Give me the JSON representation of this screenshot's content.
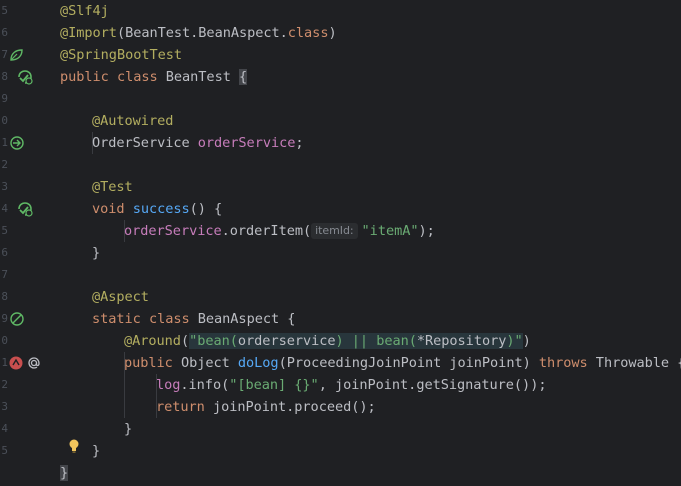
{
  "editor": {
    "line_numbers": [
      "5",
      "6",
      "7",
      "8",
      "9",
      "0",
      "1",
      "2",
      "3",
      "4",
      "5",
      "6",
      "7",
      "8",
      "9",
      "0",
      "1",
      "2",
      "3",
      "4",
      "5"
    ],
    "lines": {
      "l1": {
        "anno": "@Slf4j"
      },
      "l2": {
        "anno": "@Import",
        "p1": "(BeanTest.BeanAspect.",
        "kw": "class",
        "p2": ")"
      },
      "l3": {
        "anno": "@SpringBootTest"
      },
      "l4": {
        "kw1": "public",
        "kw2": "class",
        "p1": " BeanTest ",
        "brace": "{"
      },
      "l6": {
        "anno": "@Autowired"
      },
      "l7": {
        "p1": "OrderService ",
        "field": "orderService",
        "p2": ";"
      },
      "l9": {
        "anno": "@Test"
      },
      "l10": {
        "kw": "void",
        "fn": "success",
        "p1": "() {"
      },
      "l11": {
        "field": "orderService",
        "p1": ".orderItem(",
        "hint": "itemId:",
        "str": "\"itemA\"",
        "p2": ");"
      },
      "l12": {
        "p1": "}"
      },
      "l14": {
        "anno": "@Aspect"
      },
      "l15": {
        "kw1": "static",
        "kw2": "class",
        "p1": " BeanAspect {"
      },
      "l16": {
        "anno": "@Around",
        "p1": "(",
        "s1": "\"bean(",
        "s2": "orderservice",
        "s3": ") || bean(",
        "s4": "*Repository",
        "s5": ")\"",
        "p2": ")"
      },
      "l17": {
        "kw1": "public",
        "p1": " Object ",
        "fn": "doLog",
        "p2": "(ProceedingJoinPoint joinPoint) ",
        "kw2": "throws",
        "p3": " Throwable {"
      },
      "l18": {
        "field": "log",
        "p1": ".info(",
        "str": "\"[bean] {}\"",
        "p2": ", joinPoint.getSignature());"
      },
      "l19": {
        "kw": "return",
        "p1": " joinPoint.proceed();"
      },
      "l20": {
        "p1": "}"
      },
      "l21": {
        "p1": "}"
      },
      "l22": {
        "brace": "}"
      }
    },
    "gutter_icons": [
      "bean-leaf-icon",
      "run-test-icon",
      "navigate-bean-icon",
      "run-test-icon",
      "aspect-icon",
      "advice-icon",
      "at-icon",
      "intention-bulb-icon"
    ],
    "colors": {
      "background": "#1f2023",
      "annotation": "#b3ae60",
      "keyword": "#cf8e6d",
      "function": "#56a8f5",
      "string": "#6aab73",
      "field": "#c77dbb",
      "text": "#bcbec4"
    }
  }
}
